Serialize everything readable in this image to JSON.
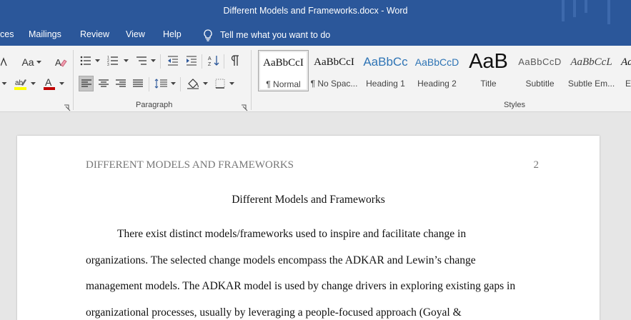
{
  "window": {
    "title": "Different Models and Frameworks.docx  -  Word"
  },
  "menu": {
    "tabs": [
      "ces",
      "Mailings",
      "Review",
      "View",
      "Help"
    ],
    "tell_me": "Tell me what you want to do"
  },
  "ribbon": {
    "font_group": {
      "case_label": "Aa"
    },
    "paragraph_group": {
      "label": "Paragraph"
    },
    "styles_group": {
      "label": "Styles",
      "styles": [
        {
          "sample": "AaBbCcI",
          "name": "¶ Normal",
          "selected": true
        },
        {
          "sample": "AaBbCcI",
          "name": "¶ No Spac..."
        },
        {
          "sample": "AaBbCc",
          "name": "Heading 1"
        },
        {
          "sample": "AaBbCcD",
          "name": "Heading 2"
        },
        {
          "sample": "AaB",
          "name": "Title"
        },
        {
          "sample": "AaBbCcD",
          "name": "Subtitle"
        },
        {
          "sample": "AaBbCcL",
          "name": "Subtle Em..."
        },
        {
          "sample": "Aa",
          "name": "Em"
        }
      ]
    }
  },
  "document": {
    "running_head": "DIFFERENT MODELS AND FRAMEWORKS",
    "page_number": "2",
    "title": "Different Models and Frameworks",
    "lines": [
      "There exist distinct models/frameworks used to inspire and facilitate change in",
      "organizations. The selected change models encompass the ADKAR and Lewin’s change",
      "management models. The ADKAR model is used by change drivers in exploring existing gaps in",
      "organizational processes, usually by leveraging a people-focused approach (Goyal &"
    ]
  },
  "colors": {
    "title_bar": "#2b579a",
    "ribbon": "#f3f3f3",
    "font_color_red": "#c00000",
    "highlight_yellow": "#ffff00",
    "workspace": "#e6e6e6"
  }
}
